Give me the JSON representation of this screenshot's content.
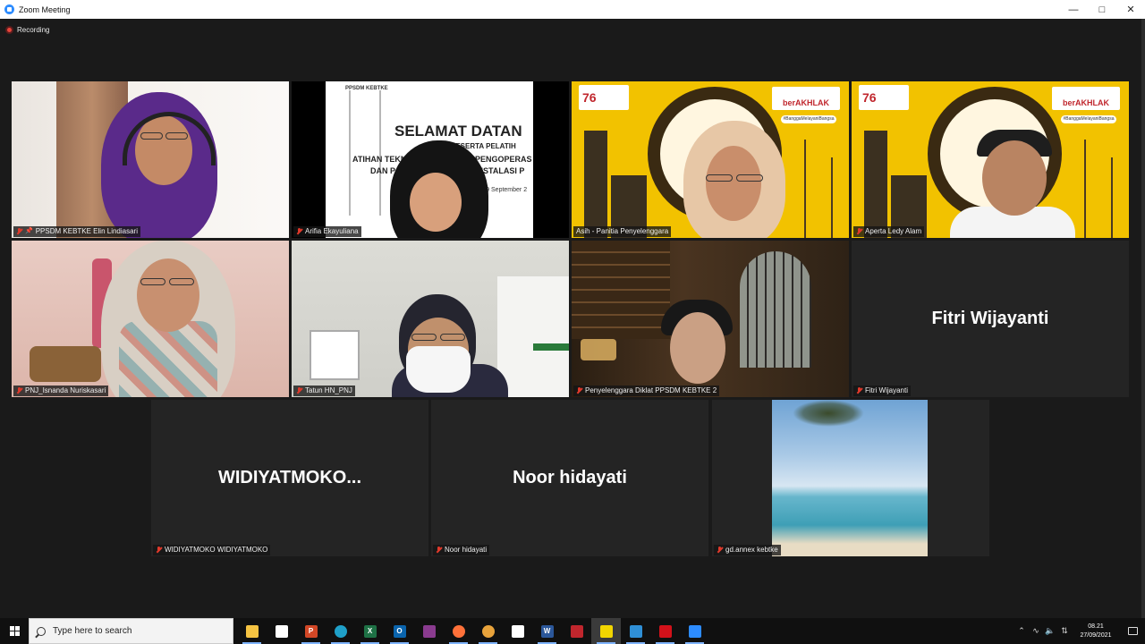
{
  "window": {
    "title": "Zoom Meeting",
    "minimize_icon": "minimize-icon",
    "maximize_icon": "maximize-icon",
    "close_icon": "close-icon"
  },
  "meeting": {
    "recording_label": "Recording",
    "active_speaker_color": "#f2de3b",
    "participants": [
      {
        "name": "PPSDM KEBTKE Elin Lindiasari",
        "muted": true,
        "pinned": true,
        "video": true,
        "slide_text": []
      },
      {
        "name": "Arifia Ekayuliana",
        "muted": true,
        "video": true,
        "slide_text": [
          "PPSDM KEBTKE",
          "SELAMAT DATAN",
          "PESERTA PELATIH",
          "ATIHAN TEKNIS P",
          "N PENGOPERAS",
          "DAN P",
          "N INSTALASI P",
          "s.d 29 September 2"
        ]
      },
      {
        "name": "Asih - Panitia Penyelenggara",
        "muted": false,
        "video": true,
        "active": true,
        "badge_text": [
          "76",
          "berAKHLAK",
          "#BanggaMelayaniBangsa"
        ]
      },
      {
        "name": "Aperta Ledy Alam",
        "muted": true,
        "video": true,
        "badge_text": [
          "76",
          "berAKHLAK",
          "#BanggaMelayaniBangsa"
        ]
      },
      {
        "name": "PNJ_Isnanda Nuriskasari",
        "muted": true,
        "video": true
      },
      {
        "name": "Tatun HN_PNJ",
        "muted": true,
        "video": true
      },
      {
        "name": "Penyelenggara Diklat PPSDM KEBTKE 2",
        "muted": true,
        "video": true
      },
      {
        "name": "Fitri Wijayanti",
        "muted": true,
        "video": false,
        "display_name": "Fitri Wijayanti"
      },
      {
        "name": "WIDIYATMOKO WIDIYATMOKO",
        "muted": true,
        "video": false,
        "display_name": "WIDIYATMOKO..."
      },
      {
        "name": "Noor hidayati",
        "muted": true,
        "video": false,
        "display_name": "Noor hidayati"
      },
      {
        "name": "gd.annex kebtke",
        "muted": true,
        "video": true
      }
    ]
  },
  "taskbar": {
    "search_placeholder": "Type here to search",
    "apps": [
      {
        "icon": "file-explorer-icon",
        "color": "#f5c342"
      },
      {
        "icon": "store-icon",
        "color": "#ffffff"
      },
      {
        "icon": "powerpoint-icon",
        "color": "#d24726",
        "letter": "P"
      },
      {
        "icon": "edge-icon",
        "color": "#1fa0c9"
      },
      {
        "icon": "excel-icon",
        "color": "#1e7145",
        "letter": "X"
      },
      {
        "icon": "outlook-icon",
        "color": "#0a64ad",
        "letter": "O"
      },
      {
        "icon": "winrar-icon",
        "color": "#8a3b8f"
      },
      {
        "icon": "firefox-icon",
        "color": "#ff7139"
      },
      {
        "icon": "chrome-icon",
        "color": "#e8a33b"
      },
      {
        "icon": "file-icon",
        "color": "#ffffff"
      },
      {
        "icon": "word-icon",
        "color": "#2b579a",
        "letter": "W"
      },
      {
        "icon": "mcafee-icon",
        "color": "#c0262d"
      },
      {
        "icon": "sticky-notes-icon",
        "color": "#f2d600"
      },
      {
        "icon": "photos-icon",
        "color": "#2f8fd6"
      },
      {
        "icon": "acrobat-icon",
        "color": "#d3111a"
      },
      {
        "icon": "zoom-icon",
        "color": "#2d8cff"
      }
    ],
    "tray": [
      "chevron-up-icon",
      "network-icon",
      "volume-icon",
      "usb-icon"
    ],
    "time": "08.21",
    "date": "27/09/2021"
  }
}
